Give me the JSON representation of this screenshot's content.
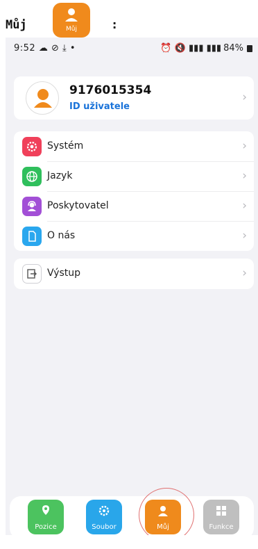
{
  "caption": {
    "title": "Můj",
    "icon_label": "Můj",
    "colon": ":"
  },
  "status": {
    "time": "9:52",
    "battery": "84%"
  },
  "profile": {
    "phone": "9176015354",
    "user_id_label": "ID uživatele"
  },
  "menu": [
    {
      "label": "Systém",
      "color": "#f0405a",
      "icon": "gear-icon"
    },
    {
      "label": "Jazyk",
      "color": "#2fbf5c",
      "icon": "globe-icon"
    },
    {
      "label": "Poskytovatel",
      "color": "#a24fd6",
      "icon": "support-agent-icon"
    },
    {
      "label": "O nás",
      "color": "#2aa7ee",
      "icon": "document-icon"
    }
  ],
  "exit": {
    "label": "Výstup",
    "icon": "exit-icon"
  },
  "tabs": [
    {
      "label": "Pozice",
      "color": "#4cc35f",
      "icon": "location-icon"
    },
    {
      "label": "Soubor",
      "color": "#29a6ea",
      "icon": "settings-icon"
    },
    {
      "label": "Můj",
      "color": "#ef8a1c",
      "icon": "person-icon",
      "active": true
    },
    {
      "label": "Funkce",
      "color": "#bfbfbf",
      "icon": "apps-icon"
    }
  ]
}
